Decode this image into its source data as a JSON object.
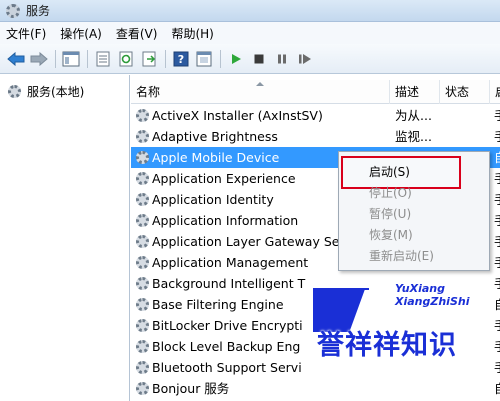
{
  "window": {
    "title": "服务"
  },
  "menu": [
    "文件(F)",
    "操作(A)",
    "查看(V)",
    "帮助(H)"
  ],
  "toolbar": {
    "icons": [
      "back-arrow-icon",
      "forward-arrow-icon",
      "show-tree-icon",
      "properties-icon",
      "refresh-icon",
      "export-list-icon",
      "help-icon",
      "console-icon",
      "start-service-icon",
      "stop-service-icon",
      "pause-service-icon",
      "restart-service-icon"
    ]
  },
  "tree": {
    "root": "服务(本地)"
  },
  "columns": {
    "name": "名称",
    "desc": "描述",
    "status": "状态",
    "startup": "启"
  },
  "rows": [
    {
      "name": "ActiveX Installer (AxInstSV)",
      "desc": "为从...",
      "startup": "手"
    },
    {
      "name": "Adaptive Brightness",
      "desc": "监视...",
      "startup": "手"
    },
    {
      "name": "Apple Mobile Device",
      "desc": "",
      "startup": "自",
      "selected": true
    },
    {
      "name": "Application Experience",
      "desc": "",
      "startup": "手"
    },
    {
      "name": "Application Identity",
      "desc": "",
      "startup": "手"
    },
    {
      "name": "Application Information",
      "desc": "",
      "startup": "手"
    },
    {
      "name": "Application Layer Gateway Servi",
      "desc": "",
      "startup": "手"
    },
    {
      "name": "Application Management",
      "desc": "",
      "startup": "手"
    },
    {
      "name": "Background Intelligent T",
      "desc": "",
      "startup": "手"
    },
    {
      "name": "Base Filtering Engine",
      "desc": "",
      "startup": "自"
    },
    {
      "name": "BitLocker Drive Encrypti",
      "desc": "",
      "startup": "手"
    },
    {
      "name": "Block Level Backup Eng",
      "desc": "",
      "startup": "手"
    },
    {
      "name": "Bluetooth Support Servi",
      "desc": "",
      "startup": "手"
    },
    {
      "name": "Bonjour 服务",
      "desc": "",
      "startup": "自"
    }
  ],
  "context_menu": {
    "start": "启动(S)",
    "stop": "停止(O)",
    "pause": "暂停(U)",
    "resume": "恢复(M)",
    "restart": "重新启动(E)"
  },
  "watermark": {
    "roman_line1": "YuXiang",
    "roman_line2": "XiangZhiShi",
    "chinese": "誉祥祥知识"
  },
  "colors": {
    "selection": "#3399ff",
    "highlight_box": "#d9001b",
    "watermark_blue": "#1a2fd6"
  }
}
